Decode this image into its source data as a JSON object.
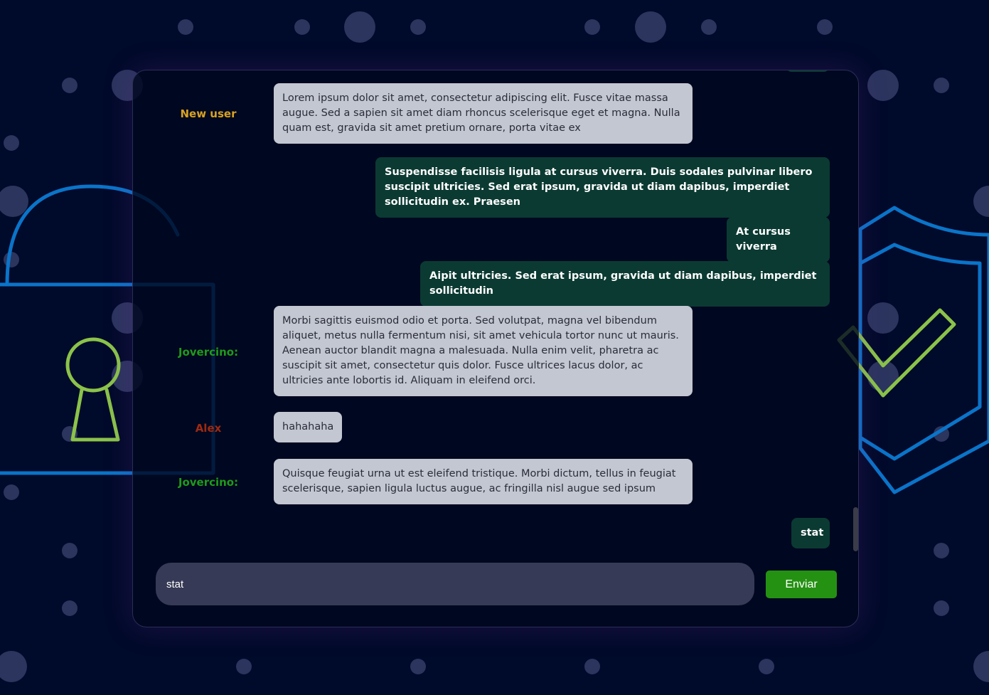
{
  "colors": {
    "background": "#000a2a",
    "bubble_incoming": "#c3c7d2",
    "bubble_outgoing": "#0b3a32",
    "send_button": "#259113",
    "input_background": "#373a56"
  },
  "messages": [
    {
      "sender": "New user",
      "sender_color": "#d9a320",
      "direction": "incoming",
      "text": "Lorem ipsum dolor sit amet, consectetur adipiscing elit. Fusce vitae massa augue. Sed a sapien sit amet diam rhoncus scelerisque eget et magna. Nulla quam est, gravida sit amet pretium ornare, porta vitae ex"
    },
    {
      "sender": "",
      "direction": "outgoing",
      "text": "Suspendisse facilisis ligula at cursus viverra. Duis sodales pulvinar libero suscipit ultricies. Sed erat ipsum, gravida ut diam dapibus, imperdiet sollicitudin ex. Praesen"
    },
    {
      "sender": "",
      "direction": "outgoing",
      "text": "At cursus viverra"
    },
    {
      "sender": "",
      "direction": "outgoing",
      "text": "Aipit ultricies. Sed erat ipsum, gravida ut diam dapibus, imperdiet sollicitudin"
    },
    {
      "sender": "Jovercino:",
      "sender_color": "#1f9a19",
      "direction": "incoming",
      "text": "Morbi sagittis euismod odio et porta. Sed volutpat, magna vel bibendum aliquet, metus nulla fermentum nisi, sit amet vehicula tortor nunc ut mauris. Aenean auctor blandit magna a malesuada. Nulla enim velit, pharetra ac suscipit sit amet, consectetur quis dolor. Fusce ultrices lacus dolor, ac ultricies ante lobortis id. Aliquam in eleifend orci."
    },
    {
      "sender": "Alex",
      "sender_color": "#9e2a12",
      "direction": "incoming",
      "text": "hahahaha"
    },
    {
      "sender": "Jovercino:",
      "sender_color": "#1f9a19",
      "direction": "incoming",
      "text": "Quisque feugiat urna ut est eleifend tristique. Morbi dictum, tellus in feugiat scelerisque, sapien ligula luctus augue, ac fringilla nisl augue sed ipsum"
    },
    {
      "sender": "",
      "direction": "outgoing",
      "text": "stat"
    }
  ],
  "input": {
    "value": "stat"
  },
  "send_label": "Enviar"
}
